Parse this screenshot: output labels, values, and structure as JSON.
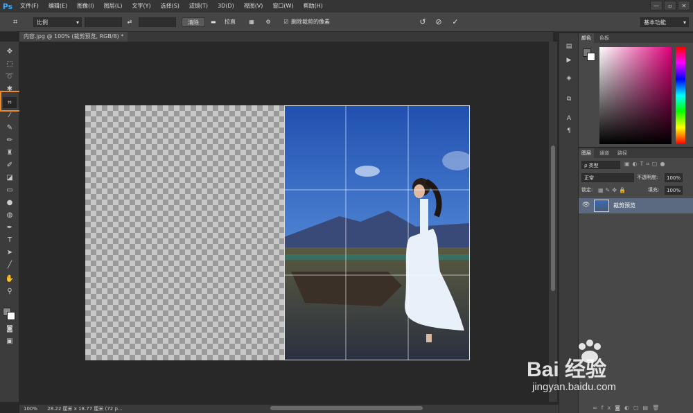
{
  "app": {
    "logo": "Ps"
  },
  "menu": [
    "文件(F)",
    "编辑(E)",
    "图像(I)",
    "图层(L)",
    "文字(Y)",
    "选择(S)",
    "滤镜(T)",
    "3D(D)",
    "视图(V)",
    "窗口(W)",
    "帮助(H)"
  ],
  "window": {
    "minimize": "—",
    "restore": "▫",
    "close": "✕"
  },
  "options": {
    "ratio_label": "比例",
    "clear_label": "清除",
    "straighten_label": "拉直",
    "delete_pixels_label": "删除裁剪的像素",
    "delete_pixels_checked": true,
    "workspace": "基本功能"
  },
  "document": {
    "tab_title": "内容.jpg @ 100% (裁剪预览, RGB/8) *"
  },
  "status": {
    "zoom": "100%",
    "info": "28.22 厘米 x 18.77 厘米 (72 p..."
  },
  "color_panel": {
    "tabs": [
      "颜色",
      "色板"
    ]
  },
  "layers_panel": {
    "tabs": [
      "图层",
      "通道",
      "路径"
    ],
    "kind_label": "ρ 类型",
    "blend_mode": "正常",
    "opacity_label": "不透明度:",
    "opacity_value": "100%",
    "lock_label": "锁定:",
    "fill_label": "填充:",
    "fill_value": "100%",
    "layer_name": "裁剪预览"
  },
  "watermark": {
    "text": "Bai 经验",
    "url": "jingyan.baidu.com"
  },
  "colors": {
    "accent": "#f08a24",
    "ps_blue": "#31a8ff",
    "selected_layer": "#5b6a80"
  }
}
